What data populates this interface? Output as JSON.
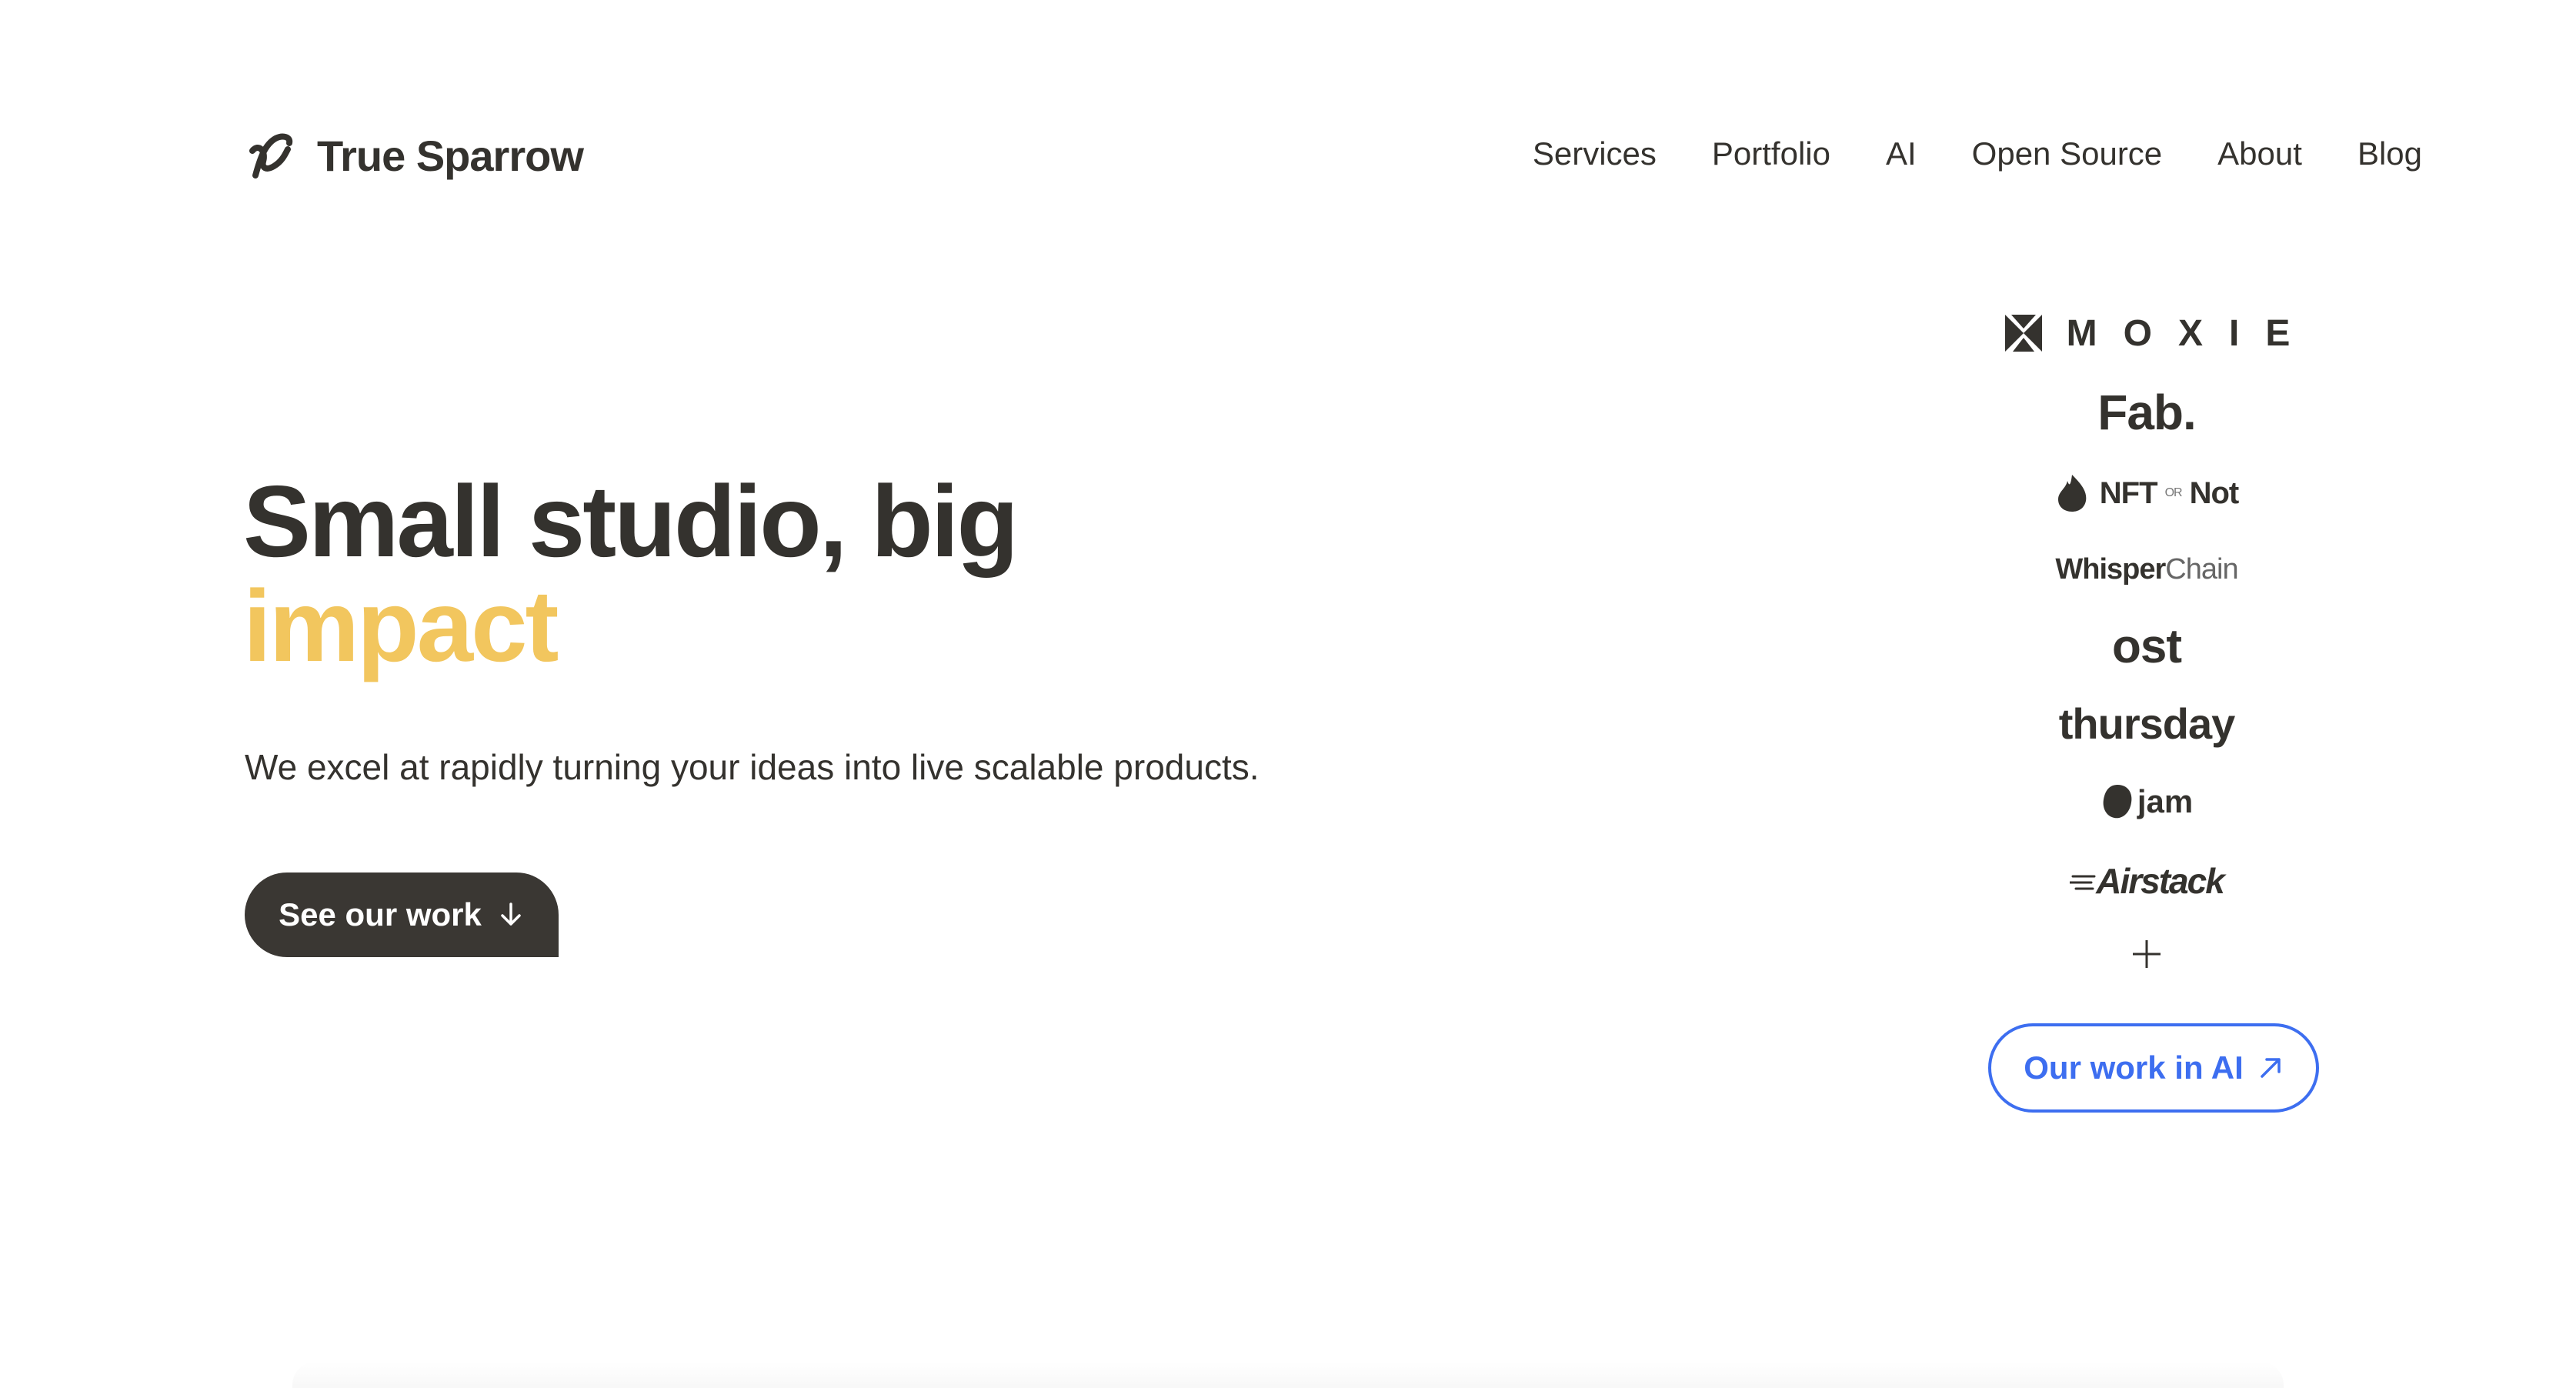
{
  "brand": {
    "name": "True Sparrow",
    "logo_icon": "sparrow-logo-icon"
  },
  "nav": {
    "items": [
      {
        "label": "Services"
      },
      {
        "label": "Portfolio"
      },
      {
        "label": "AI"
      },
      {
        "label": "Open Source"
      },
      {
        "label": "About"
      },
      {
        "label": "Blog"
      }
    ]
  },
  "hero": {
    "title_line1": "Small studio, big",
    "title_line2": "impact",
    "subtitle": "We excel at rapidly turning your ideas into live scalable products.",
    "cta_label": "See our work",
    "cta_icon": "arrow-down-icon"
  },
  "clients": {
    "moxie": "MOXIE",
    "fab": "Fab.",
    "nftornot_left": "NFT",
    "nftornot_or": "OR",
    "nftornot_right": "Not",
    "whisperchain_bold": "Whisper",
    "whisperchain_light": "Chain",
    "ost": "ost",
    "thursday": "thursday",
    "jam": "jam",
    "airstack": "Airstack",
    "more_icon": "plus-icon"
  },
  "ai_button": {
    "label": "Our work in AI",
    "icon": "arrow-up-right-icon"
  },
  "colors": {
    "text": "#34322e",
    "accent_yellow": "#f2c65e",
    "cta_bg": "#3a3733",
    "link_blue": "#3d6ef0"
  }
}
